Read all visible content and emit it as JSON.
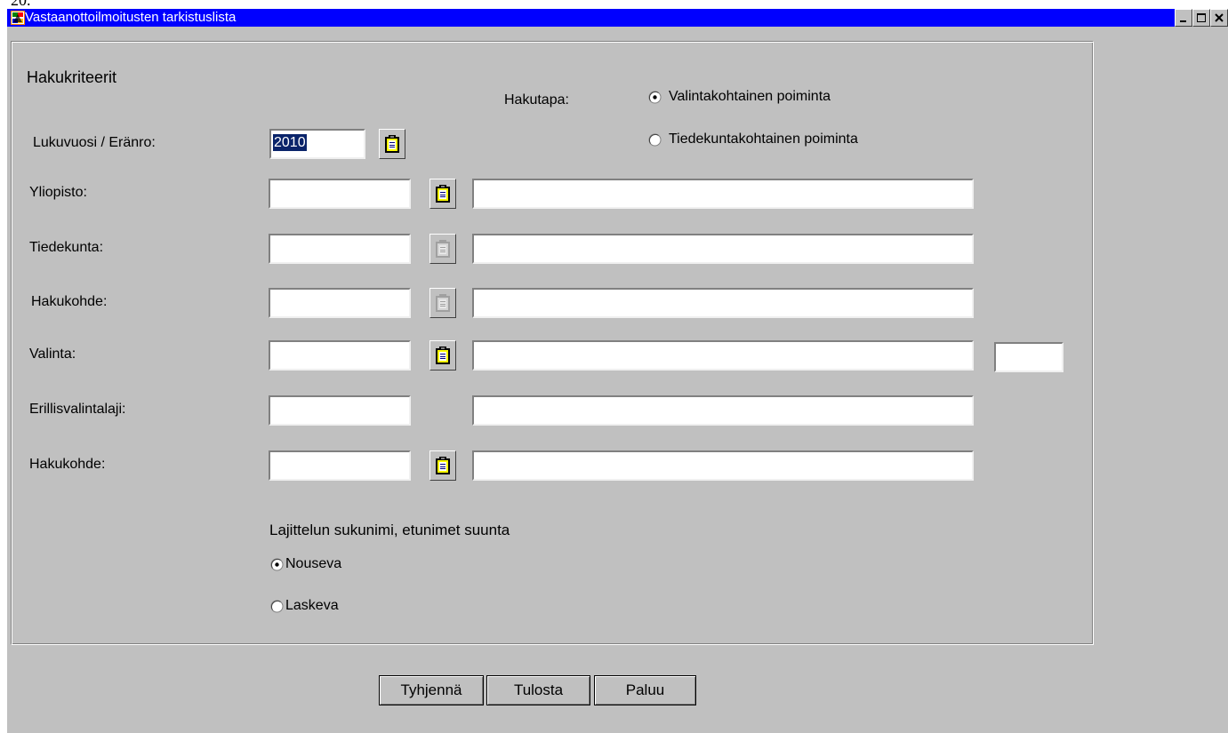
{
  "corner_text": "20.",
  "window": {
    "title": "Vastaanottoilmoitusten tarkistuslista"
  },
  "form": {
    "section_title": "Hakukriteerit",
    "hakutapa": {
      "label": "Hakutapa:",
      "options": [
        {
          "label": "Valintakohtainen poiminta",
          "selected": true
        },
        {
          "label": "Tiedekuntakohtainen poiminta",
          "selected": false
        }
      ]
    },
    "lukuvuosi": {
      "label": "Lukuvuosi / Eränro:",
      "value": "2010"
    },
    "rows": [
      {
        "label": "Yliopisto:",
        "code": "",
        "name": "",
        "lov": "enabled"
      },
      {
        "label": "Tiedekunta:",
        "code": "",
        "name": "",
        "lov": "disabled"
      },
      {
        "label": "Hakukohde:",
        "code": "",
        "name": "",
        "lov": "disabled"
      },
      {
        "label": "Valinta:",
        "code": "",
        "name": "",
        "lov": "enabled",
        "extra": ""
      },
      {
        "label": "Erillisvalintalaji:",
        "code": "",
        "name": "",
        "lov": "none"
      },
      {
        "label": "Hakukohde:",
        "code": "",
        "name": "",
        "lov": "enabled"
      }
    ],
    "sort": {
      "title": "Lajittelun sukunimi, etunimet suunta",
      "options": [
        {
          "label": "Nouseva",
          "selected": true
        },
        {
          "label": "Laskeva",
          "selected": false
        }
      ]
    }
  },
  "buttons": {
    "clear": "Tyhjennä",
    "print": "Tulosta",
    "back": "Paluu"
  },
  "icons": {
    "app": "app-icon",
    "lov": "clipboard-icon",
    "minimize": "minimize-icon",
    "maximize": "maximize-icon",
    "close": "close-icon"
  },
  "colors": {
    "titlebar": "#0000ff",
    "window_bg": "#c0c0c0",
    "selection": "#0a246a"
  }
}
